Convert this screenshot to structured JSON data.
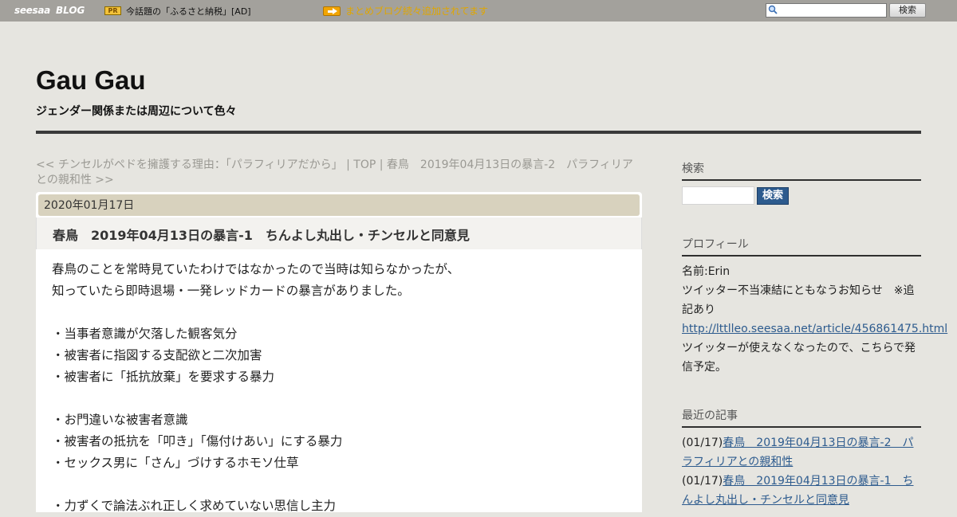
{
  "topbar": {
    "logo_seesaa": "seesaa",
    "logo_blog": "BLOG",
    "pr_badge": "PR",
    "pr_text": "今話題の「ふるさと納税」[AD]",
    "notice_text": "まとめブログ続々追加されてます",
    "search_button": "検索",
    "colors": {
      "bar": "#a3a19c",
      "notice": "#e0a600"
    }
  },
  "blog": {
    "title": "Gau Gau",
    "description": "ジェンダー関係または周辺について色々"
  },
  "post_nav": {
    "prev": "<< チンセルがペドを擁護する理由：「パラフィリアだから」",
    "sep1": " | ",
    "top": "TOP",
    "sep2": " | ",
    "next": "春鳥　2019年04月13日の暴言-2　パラフィリアとの親和性 >>"
  },
  "post": {
    "date": "2020年01月17日",
    "title": "春鳥　2019年04月13日の暴言-1　ちんよし丸出し・チンセルと同意見",
    "lines": [
      "春鳥のことを常時見ていたわけではなかったので当時は知らなかったが、",
      "知っていたら即時退場・一発レッドカードの暴言がありました。",
      "",
      "・当事者意識が欠落した観客気分",
      "・被害者に指図する支配欲と二次加害",
      "・被害者に「抵抗放棄」を要求する暴力",
      "",
      "・お門違いな被害者意識",
      "・被害者の抵抗を「叩き」「傷付けあい」にする暴力",
      "・セックス男に「さん」づけするホモソ仕草",
      "",
      "・力ずくで論法ぶれ正しく求めていない思信し主力"
    ]
  },
  "sidebar": {
    "search_heading": "検索",
    "search_button": "検索",
    "profile_heading": "プロフィール",
    "profile_name": "名前:Erin",
    "profile_notice": "ツイッター不当凍結にともなうお知らせ　※追記あり",
    "profile_link": "http://lttlleo.seesaa.net/article/456861475.html",
    "profile_note": "ツイッターが使えなくなったので、こちらで発信予定。",
    "recent_heading": "最近の記事",
    "recent": [
      {
        "date": "(01/17)",
        "title": "春鳥　2019年04月13日の暴言-2　パラフィリアとの親和性"
      },
      {
        "date": "(01/17)",
        "title": "春鳥　2019年04月13日の暴言-1　ちんよし丸出し・チンセルと同意見"
      }
    ],
    "colors": {
      "link": "#2d5b8e",
      "button": "#2d5b8e"
    }
  }
}
